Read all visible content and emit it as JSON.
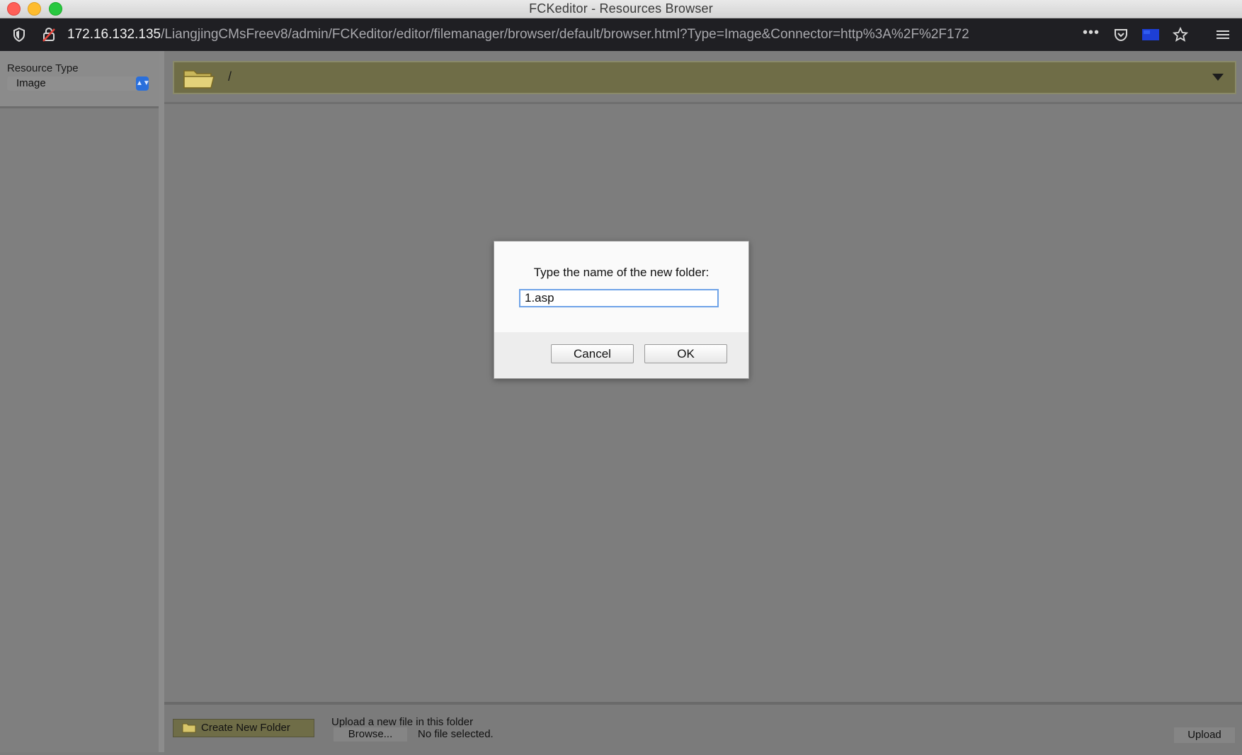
{
  "window": {
    "title": "FCKeditor - Resources Browser"
  },
  "browser": {
    "url_host": "172.16.132.135",
    "url_path": "/LiangjingCMsFreev8/admin/FCKeditor/editor/filemanager/browser/default/browser.html?Type=Image&Connector=http%3A%2F%2F172",
    "more_glyph": "•••"
  },
  "sidebar": {
    "resource_type_label": "Resource Type",
    "resource_type_value": "Image"
  },
  "folder_bar": {
    "current_path": "/"
  },
  "bottom": {
    "create_folder_label": "Create New Folder",
    "upload_label": "Upload a new file in this folder",
    "browse_label": "Browse...",
    "no_file_text": "No file selected.",
    "upload_button": "Upload"
  },
  "dialog": {
    "prompt": "Type the name of the new folder:",
    "input_value": "1.asp",
    "cancel_label": "Cancel",
    "ok_label": "OK"
  },
  "colors": {
    "folder_bar_bg": "#6f6d47",
    "dialog_input_border": "#6fa3e8",
    "select_accent": "#2a6fdb"
  }
}
